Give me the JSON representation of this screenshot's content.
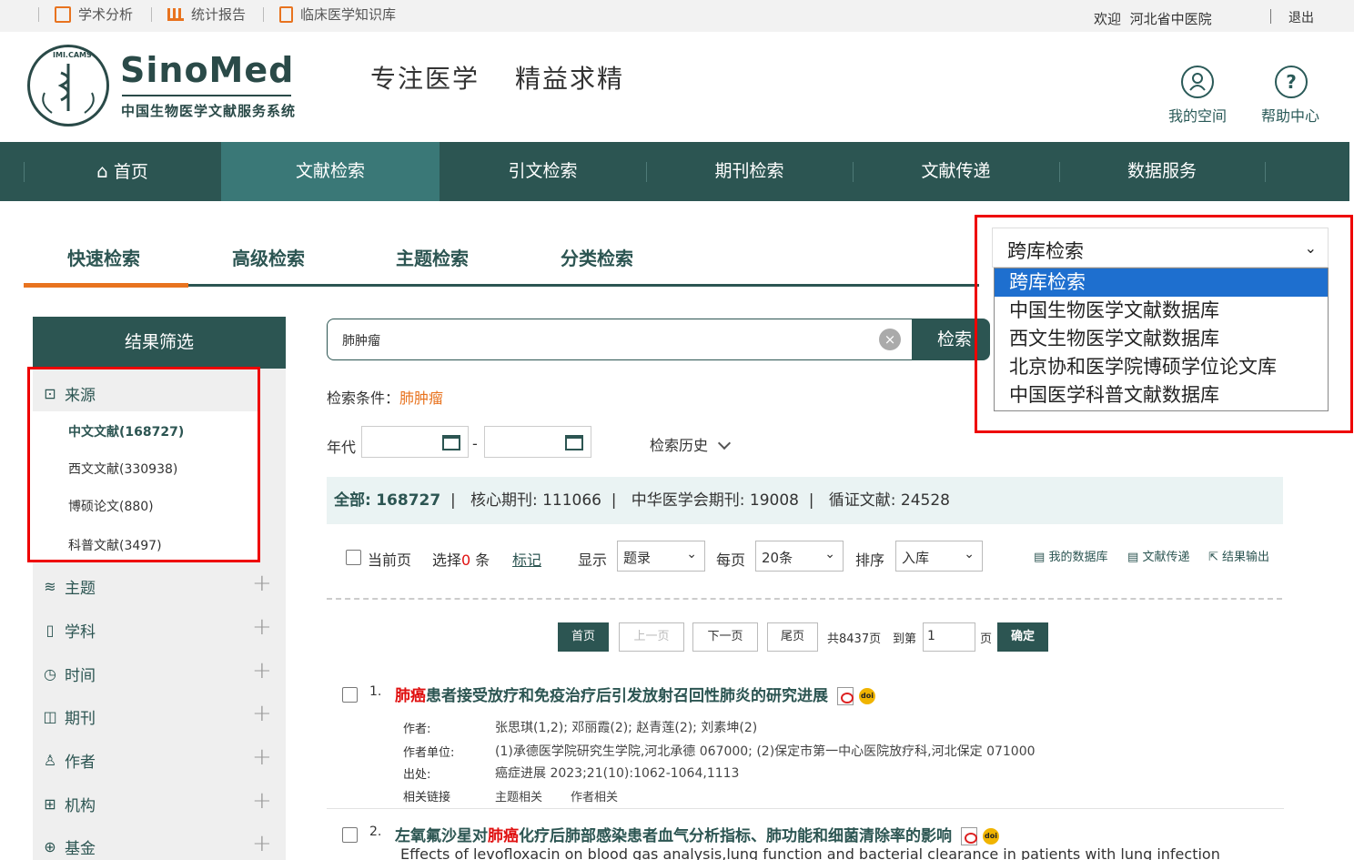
{
  "topbar": {
    "links": [
      "学术分析",
      "统计报告",
      "临床医学知识库"
    ],
    "welcome": "欢迎",
    "user": "河北省中医院",
    "logout": "退出"
  },
  "header": {
    "logo_badge": "IMI.CAMS",
    "logo_name": "SinoMed",
    "logo_sub": "中国生物医学文献服务系统",
    "slogan_1": "专注医学",
    "slogan_2": "精益求精",
    "my_space": "我的空间",
    "help": "帮助中心"
  },
  "nav": [
    "首页",
    "文献检索",
    "引文检索",
    "期刊检索",
    "文献传递",
    "数据服务"
  ],
  "tabs": [
    "快速检索",
    "高级检索",
    "主题检索",
    "分类检索"
  ],
  "db_select": {
    "value": "跨库检索",
    "options": [
      "跨库检索",
      "中国生物医学文献数据库",
      "西文生物医学文献数据库",
      "北京协和医学院博硕学位论文库",
      "中国医学科普文献数据库"
    ]
  },
  "sidebar": {
    "title": "结果筛选",
    "source_label": "来源",
    "sources": [
      "中文文献(168727)",
      "西文文献(330938)",
      "博硕论文(880)",
      "科普文献(3497)"
    ],
    "facets": [
      "主题",
      "学科",
      "时间",
      "期刊",
      "作者",
      "机构",
      "基金"
    ]
  },
  "search": {
    "value": "肺肿瘤",
    "button": "检索",
    "cond_label": "检索条件：",
    "cond_value": "肺肿瘤",
    "year_label": "年代",
    "dash": "-",
    "history": "检索历史"
  },
  "stats": {
    "all_label": "全部:",
    "all": "168727",
    "core_label": "核心期刊:",
    "core": "111066",
    "cma_label": "中华医学会期刊:",
    "cma": "19008",
    "ebm_label": "循证文献:",
    "ebm": "24528"
  },
  "toolbar": {
    "current_page": "当前页",
    "selected_pre": "选择",
    "selected_count": "0",
    "selected_post": "条",
    "mark": "标记",
    "display_label": "显示",
    "display_value": "题录",
    "per_page_label": "每页",
    "per_page_value": "20条",
    "sort_label": "排序",
    "sort_value": "入库",
    "my_db": "我的数据库",
    "delivery": "文献传递",
    "export": "结果输出"
  },
  "pager": {
    "first": "首页",
    "prev": "上一页",
    "next": "下一页",
    "last": "尾页",
    "total": "共8437页",
    "goto": "到第",
    "page_value": "1",
    "page_unit": "页",
    "confirm": "确定"
  },
  "results": [
    {
      "num": "1.",
      "title_kw": "肺癌",
      "title_rest": "患者接受放疗和免疫治疗后引发放射召回性肺炎的研究进展",
      "labels": {
        "author": "作者:",
        "affil": "作者单位:",
        "source": "出处:",
        "links": "相关链接"
      },
      "author": "张思琪(1,2); 邓丽霞(2); 赵青莲(2); 刘素坤(2)",
      "affil": "(1)承德医学院研究生学院,河北承德 067000; (2)保定市第一中心医院放疗科,河北保定 071000",
      "source": "癌症进展 2023;21(10):1062-1064,1113",
      "link1": "主题相关",
      "link2": "作者相关"
    },
    {
      "num": "2.",
      "title_pre": "左氧氟沙星对",
      "title_kw": "肺癌",
      "title_rest": "化疗后肺部感染患者血气分析指标、肺功能和细菌清除率的影响",
      "en_title": "Effects of levofloxacin on blood gas analysis,lung function and bacterial clearance in patients with lung infection"
    }
  ],
  "colors": {
    "primary": "#2c5552",
    "nav_active": "#3a7877",
    "accent": "#e8731f",
    "keyword": "#e01010",
    "highlight": "#1e6fcf",
    "annotation": "#e00000"
  }
}
